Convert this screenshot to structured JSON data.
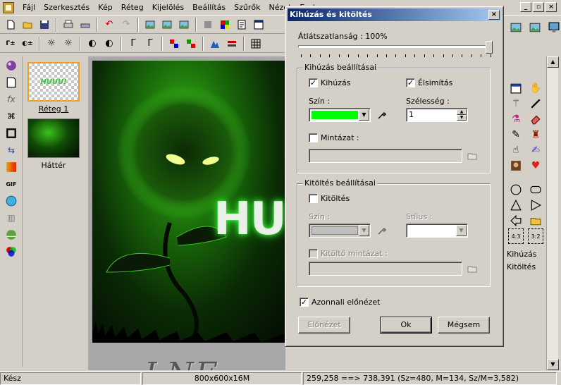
{
  "menu": {
    "items": [
      "Fájl",
      "Szerkesztés",
      "Kép",
      "Réteg",
      "Kijelölés",
      "Beállítás",
      "Szűrők",
      "Nézet",
      "Eszk"
    ]
  },
  "layers": {
    "items": [
      {
        "label": "Réteg 1",
        "thumb_text": "HUUU!"
      },
      {
        "label": "Háttér"
      }
    ]
  },
  "canvas": {
    "watermark": "LNE",
    "title_text": "HU"
  },
  "right_panel": {
    "labels": [
      "Kihúzás",
      "Kitöltés"
    ]
  },
  "status": {
    "ready": "Kész",
    "size": "800x600x16M",
    "coords": "259,258 ==> 738,391 (Sz=480, M=134, Sz/M=3,582)"
  },
  "dialog": {
    "title": "Kihúzás és kitöltés",
    "opacity_label": "Átlátszatlanság : 100%",
    "opacity_value": 100,
    "stroke_group": {
      "title": "Kihúzás beállításai",
      "stroke_label": "Kihúzás",
      "stroke_checked": true,
      "antialias_label": "Élsimítás",
      "antialias_checked": true,
      "color_label": "Szín :",
      "color_value": "#00ff00",
      "width_label": "Szélesség :",
      "width_value": "1",
      "pattern_label": "Mintázat :",
      "pattern_checked": false
    },
    "fill_group": {
      "title": "Kitöltés beállításai",
      "fill_label": "Kitöltés",
      "fill_checked": false,
      "color_label": "Szín :",
      "style_label": "Stílus :",
      "pattern_label": "Kitöltő mintázat :",
      "pattern_checked": false
    },
    "preview_label": "Azonnali előnézet",
    "preview_checked": true,
    "buttons": {
      "preview": "Előnézet",
      "ok": "Ok",
      "cancel": "Mégsem"
    }
  }
}
